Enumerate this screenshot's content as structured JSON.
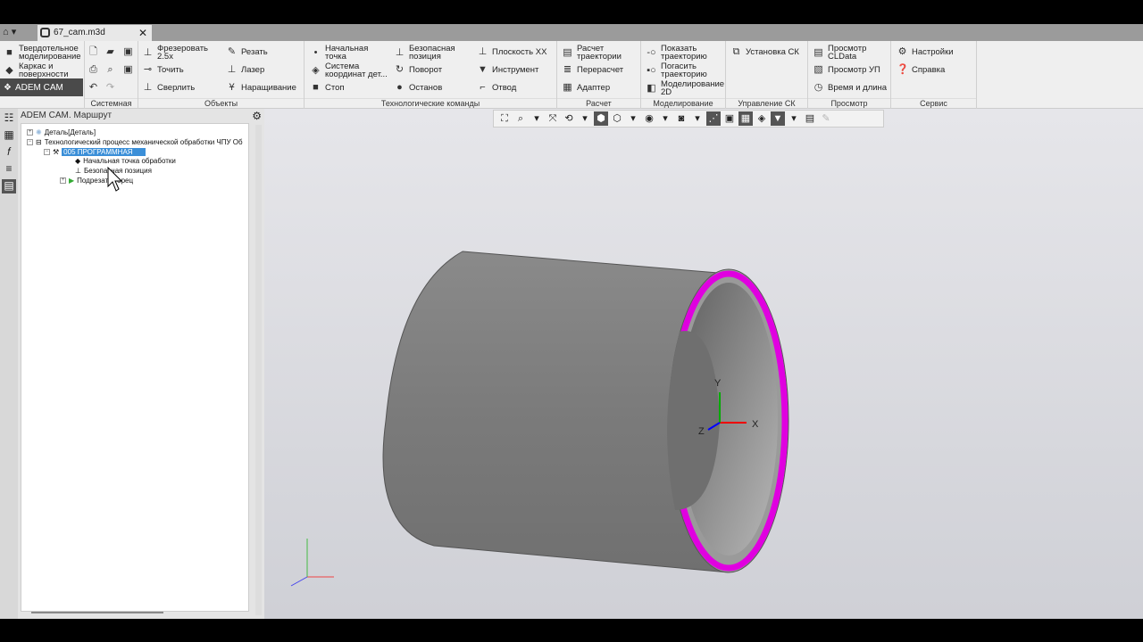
{
  "tab": {
    "filename": "67_cam.m3d",
    "close": "✕"
  },
  "ribbon": {
    "sidebar": {
      "solid": "Твердотельное моделирование",
      "frame": "Каркас и поверхности",
      "adem": "ADEM CAM"
    },
    "system": {
      "label": "Системная"
    },
    "objects": {
      "label": "Объекты",
      "mill": "Фрезеровать 2.5х",
      "turn": "Точить",
      "drill": "Сверлить",
      "cut": "Резать",
      "laser": "Лазер",
      "build": "Наращивание"
    },
    "tech": {
      "label": "Технологические команды",
      "start": "Начальная точка",
      "cs": "Система координат дет...",
      "stop": "Стоп",
      "safe": "Безопасная позиция",
      "rotate": "Поворот",
      "halt": "Останов",
      "plane": "Плоскость XX",
      "tool": "Инструмент",
      "retract": "Отвод"
    },
    "calc": {
      "label": "Расчет",
      "path": "Расчет траектории",
      "recalc": "Перерасчет",
      "adapter": "Адаптер"
    },
    "model": {
      "label": "Моделирование",
      "show": "Показать траекторию",
      "hide": "Погасить траекторию",
      "m2d": "Моделирование 2D"
    },
    "cs": {
      "label": "Управление СК",
      "set": "Установка СК"
    },
    "view": {
      "label": "Просмотр",
      "cldata": "Просмотр CLData",
      "up": "Просмотр УП",
      "time": "Время и длина"
    },
    "service": {
      "label": "Сервис",
      "settings": "Настройки",
      "help": "Справка"
    }
  },
  "panel": {
    "title": "ADEM CAM. Маршрут",
    "tree": [
      "Деталь[Деталь]",
      "Технологический процесс механической обработки ЧПУ   Об",
      "005 ПРОГРАММНАЯ",
      "Начальная точка обработки",
      "Безопасная позиция",
      "Подрезать торец"
    ]
  },
  "viewport": {
    "axis_x": "X",
    "axis_y": "Y",
    "axis_z": "Z",
    "ring_color": "#e000e0"
  }
}
